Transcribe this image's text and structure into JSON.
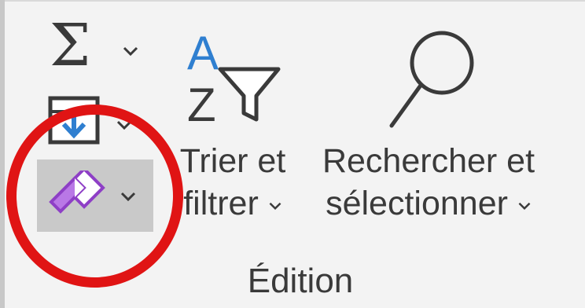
{
  "ribbon_group": {
    "name": "Édition",
    "autosum": {
      "icon": "autosum-sigma-icon"
    },
    "fill": {
      "icon": "fill-down-icon"
    },
    "clear": {
      "icon": "eraser-icon",
      "highlighted": true
    },
    "sort_filter": {
      "icon": "sort-az-filter-icon",
      "label_line1": "Trier et",
      "label_line2": "filtrer"
    },
    "find_select": {
      "icon": "magnifier-icon",
      "label_line1": "Rechercher et",
      "label_line2": "sélectionner"
    }
  },
  "colors": {
    "annotation_circle": "#e01414",
    "eraser": "#a65ad6",
    "fill_arrow": "#2f7fd0",
    "sort_a_letter": "#2f7fd0",
    "clear_highlight_bg": "#c9c9c9"
  }
}
